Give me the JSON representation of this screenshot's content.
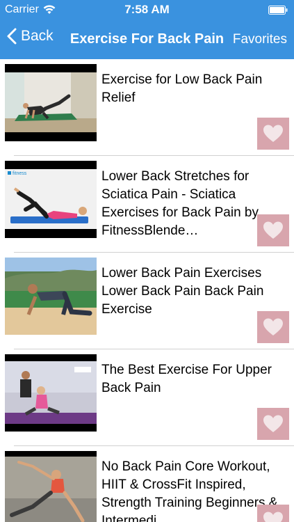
{
  "status": {
    "carrier": "Carrier",
    "time": "7:58 AM"
  },
  "nav": {
    "back_label": "Back",
    "title": "Exercise For Back Pain",
    "favorites_label": "Favorites"
  },
  "videos": [
    {
      "title": "Exercise for Low Back Pain Relief"
    },
    {
      "title": "Lower Back Stretches for Sciatica Pain - Sciatica Exercises for Back Pain by FitnessBlende…",
      "thumb_logo": "fitness"
    },
    {
      "title": "Lower Back Pain Exercises Lower Back Pain Back Pain Exercise"
    },
    {
      "title": "The Best Exercise For Upper Back Pain"
    },
    {
      "title": "No Back Pain Core Workout, HIIT & CrossFit Inspired, Strength Training Beginners & Intermedi…"
    }
  ],
  "colors": {
    "nav_bar": "#3a92df",
    "heart_button": "#d8a5ad"
  }
}
